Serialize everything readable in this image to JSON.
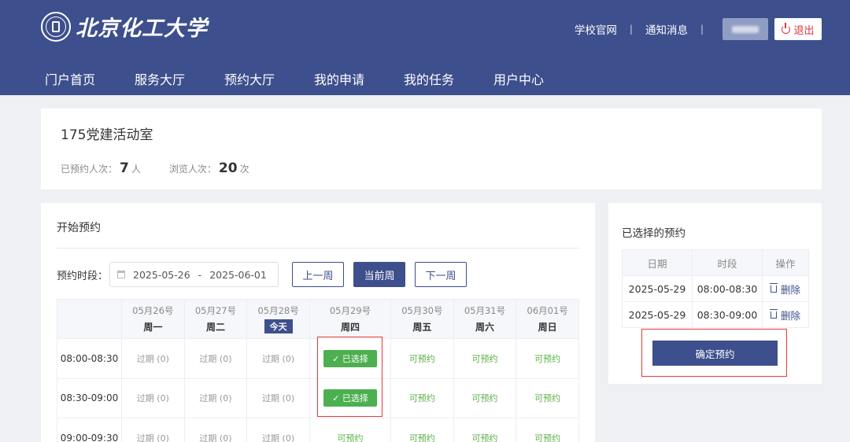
{
  "header": {
    "logo_text": "北京化工大学",
    "links": [
      "学校官网",
      "通知消息"
    ],
    "logout_label": "退出"
  },
  "nav": {
    "items": [
      "门户首页",
      "服务大厅",
      "预约大厅",
      "我的申请",
      "我的任务",
      "用户中心"
    ]
  },
  "room": {
    "title": "175党建活动室",
    "booked_label": "已预约人次：",
    "booked_count": "7",
    "booked_unit": "人",
    "views_label": "浏览人次：",
    "views_count": "20",
    "views_unit": "次"
  },
  "booking": {
    "title": "开始预约",
    "period_label": "预约时段：",
    "date_start": "2025-05-26",
    "date_sep": "-",
    "date_end": "2025-06-01",
    "prev_week": "上一周",
    "current_week": "当前周",
    "next_week": "下一周",
    "days": [
      {
        "date": "05月26号",
        "weekday": "周一"
      },
      {
        "date": "05月27号",
        "weekday": "周二"
      },
      {
        "date": "05月28号",
        "weekday": "今天"
      },
      {
        "date": "05月29号",
        "weekday": "周四"
      },
      {
        "date": "05月30号",
        "weekday": "周五"
      },
      {
        "date": "05月31号",
        "weekday": "周六"
      },
      {
        "date": "06月01号",
        "weekday": "周日"
      }
    ],
    "rows": [
      {
        "time": "08:00-08:30",
        "cells": [
          "过期 (0)",
          "过期 (0)",
          "过期 (0)",
          "✓ 已选择",
          "可预约",
          "可预约",
          "可预约"
        ]
      },
      {
        "time": "08:30-09:00",
        "cells": [
          "过期 (0)",
          "过期 (0)",
          "过期 (0)",
          "✓ 已选择",
          "可预约",
          "可预约",
          "可预约"
        ]
      },
      {
        "time": "09:00-09:30",
        "cells": [
          "过期 (0)",
          "过期 (0)",
          "过期 (0)",
          "可预约",
          "可预约",
          "可预约",
          "可预约"
        ]
      }
    ]
  },
  "selected": {
    "title": "已选择的预约",
    "headers": [
      "日期",
      "时段",
      "操作"
    ],
    "rows": [
      {
        "date": "2025-05-29",
        "slot": "08:00-08:30",
        "action": "删除"
      },
      {
        "date": "2025-05-29",
        "slot": "08:30-09:00",
        "action": "删除"
      }
    ],
    "confirm_label": "确定预约"
  },
  "colors": {
    "primary": "#3d4f8c",
    "selected_green": "#4caf50",
    "available_green": "#5ab047",
    "highlight_red": "#e53935"
  }
}
